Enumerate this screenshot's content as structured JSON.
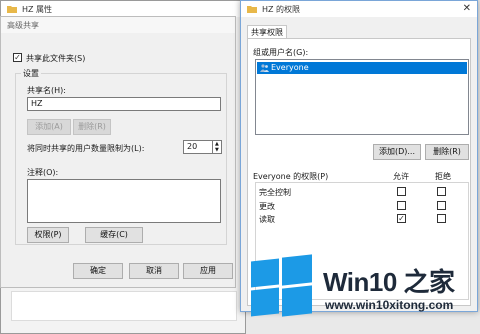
{
  "properties_window": {
    "title": "HZ 属性"
  },
  "advanced_sharing": {
    "title": "高级共享",
    "share_checkbox_label": "共享此文件夹(S)",
    "share_checked": true,
    "settings_label": "设置",
    "share_name_label": "共享名(H):",
    "share_name_value": "HZ",
    "add_button": "添加(A)",
    "remove_button": "删除(R)",
    "user_limit_label": "将同时共享的用户数量限制为(L):",
    "user_limit_value": "20",
    "comment_label": "注释(O):",
    "permissions_button": "权限(P)",
    "caching_button": "缓存(C)",
    "ok_button": "确定",
    "cancel_button": "取消",
    "apply_button": "应用"
  },
  "permissions_dialog": {
    "title": "HZ 的权限",
    "tab_label": "共享权限",
    "group_label": "组或用户名(G):",
    "users": [
      "Everyone"
    ],
    "selected_user_index": 0,
    "add_button": "添加(D)...",
    "remove_button": "删除(R)",
    "perm_header": "Everyone 的权限(P)",
    "allow_header": "允许",
    "deny_header": "拒绝",
    "permissions": [
      {
        "name": "完全控制",
        "allow": false,
        "deny": false
      },
      {
        "name": "更改",
        "allow": false,
        "deny": false
      },
      {
        "name": "读取",
        "allow": true,
        "deny": false
      }
    ]
  },
  "watermark": {
    "title": "Win10 之家",
    "url": "www.win10xitong.com",
    "color": "#1c9ae6"
  }
}
